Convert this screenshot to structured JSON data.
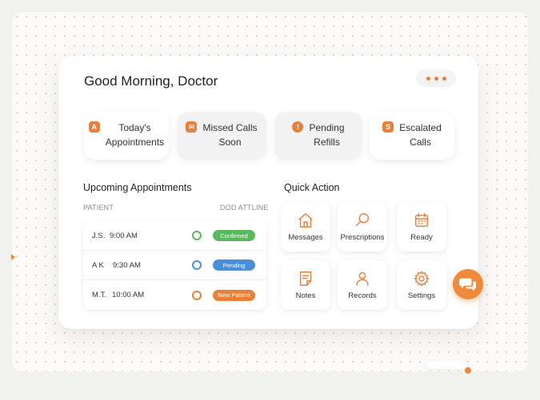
{
  "header": {
    "greeting": "Good Morning, Doctor",
    "menu_icon": "more-dots-icon"
  },
  "stats": [
    {
      "icon_glyph": "A",
      "icon": "calendar-a-icon",
      "line1": "Today's",
      "line2": "Appointments"
    },
    {
      "icon_glyph": "✉",
      "icon": "envelope-icon",
      "line1": "Missed Calls",
      "line2": "Soon"
    },
    {
      "icon_glyph": "!",
      "icon": "refill-alert-icon",
      "line1": "Pending",
      "line2": "Refills"
    },
    {
      "icon_glyph": "S",
      "icon": "escalation-icon",
      "line1": "Escalated",
      "line2": "Calls"
    }
  ],
  "appointments": {
    "title": "Upcoming Appointments",
    "col_patient": "PATIENT",
    "col_status": "DOD ATTLINE",
    "rows": [
      {
        "patient": "J.S.",
        "time": "9:00 AM",
        "status": "Confirmed",
        "status_color": "#5cb85c"
      },
      {
        "patient": "A K",
        "time": "9:30 AM",
        "status": "Pending",
        "status_color": "#4a90d9"
      },
      {
        "patient": "M.T.",
        "time": "10:00 AM",
        "status": "New Patient",
        "status_color": "#e8803a"
      }
    ]
  },
  "quick_action": {
    "title": "Quick Action",
    "items": [
      {
        "label": "Messages",
        "icon": "home-icon"
      },
      {
        "label": "Prescriptions",
        "icon": "search-icon"
      },
      {
        "label": "Ready",
        "icon": "calendar-icon"
      },
      {
        "label": "Notes",
        "icon": "notes-icon"
      },
      {
        "label": "Records",
        "icon": "user-icon"
      },
      {
        "label": "Settings",
        "icon": "gear-icon"
      }
    ]
  },
  "colors": {
    "accent": "#e8803a",
    "confirmed": "#5cb85c",
    "pending": "#4a90d9",
    "new_patient": "#e8803a"
  },
  "chat": {
    "icon": "chat-icon"
  }
}
